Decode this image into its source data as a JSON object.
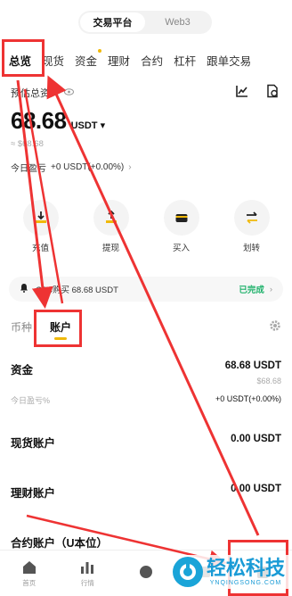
{
  "segment": {
    "options": [
      "交易平台",
      "Web3"
    ],
    "active": 0
  },
  "tabs": [
    "总览",
    "现货",
    "资金",
    "理财",
    "合约",
    "杠杆",
    "跟单交易"
  ],
  "estimate": {
    "label": "预估总资产"
  },
  "balance": {
    "value": "68.68",
    "currency": "USDT ▾",
    "fiat": "≈ $68.68"
  },
  "pnl": {
    "label": "今日盈亏",
    "value": "+0 USDT(+0.00%)",
    "arrow": "›"
  },
  "actions": [
    {
      "label": "充值",
      "icon": "deposit-icon"
    },
    {
      "label": "提现",
      "icon": "withdraw-icon"
    },
    {
      "label": "买入",
      "icon": "buy-icon"
    },
    {
      "label": "划转",
      "icon": "transfer-icon"
    }
  ],
  "notice": {
    "text": "C2C购买 68.68 USDT",
    "status": "已完成",
    "chevron": "›"
  },
  "subtabs": [
    "币种",
    "账户"
  ],
  "funds": {
    "title": "资金",
    "value": "68.68 USDT",
    "fiat": "$68.68",
    "pnl_label": "今日盈亏%",
    "pnl_value": "+0 USDT(+0.00%)"
  },
  "accounts": [
    {
      "name": "现货账户",
      "value": "0.00 USDT"
    },
    {
      "name": "理财账户",
      "value": "0.00 USDT"
    },
    {
      "name": "合约账户（U本位）",
      "value": ""
    }
  ],
  "nav": [
    {
      "label": "首页",
      "icon": "home-icon"
    },
    {
      "label": "行情",
      "icon": "markets-icon"
    },
    {
      "label": "",
      "icon": "trade-icon"
    },
    {
      "label": "",
      "icon": "finance-icon"
    },
    {
      "label": "",
      "icon": "assets-icon"
    }
  ],
  "watermark": {
    "title": "轻松科技",
    "url": "YNQINGSONG.COM"
  },
  "colors": {
    "accent": "#f0b90b",
    "success": "#20b26c",
    "annotation": "#e33333"
  }
}
